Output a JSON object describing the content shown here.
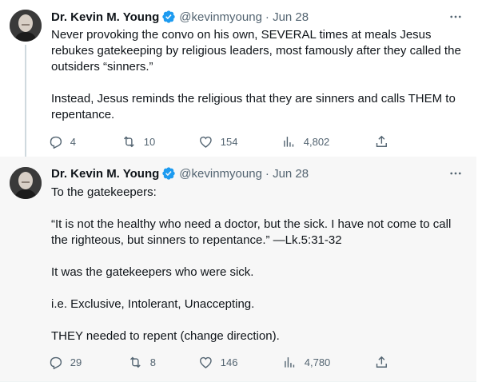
{
  "colors": {
    "text": "#0f1419",
    "secondary": "#536471",
    "verified": "#1d9bf0",
    "thread_line": "#cfd9de",
    "highlight_bg": "#f7f7f7"
  },
  "tweets": [
    {
      "author": {
        "name": "Dr. Kevin M. Young",
        "handle": "@kevinmyoung",
        "date": "· Jun 28"
      },
      "text": [
        "Never provoking the convo on his own, SEVERAL times at meals Jesus rebukes gatekeeping by religious leaders, most famously after they called the outsiders “sinners.”",
        "Instead, Jesus reminds the religious that they are sinners and calls THEM to repentance."
      ],
      "stats": {
        "replies": "4",
        "retweets": "10",
        "likes": "154",
        "views": "4,802"
      }
    },
    {
      "author": {
        "name": "Dr. Kevin M. Young",
        "handle": "@kevinmyoung",
        "date": "· Jun 28"
      },
      "text": [
        "To the gatekeepers:",
        "“It is not the healthy who need a doctor, but the sick. I have not come to call the righteous, but sinners to repentance.” —Lk.5:31-32",
        "It was the gatekeepers who were sick.",
        "i.e. Exclusive, Intolerant, Unaccepting.",
        "THEY needed to repent (change direction)."
      ],
      "stats": {
        "replies": "29",
        "retweets": "8",
        "likes": "146",
        "views": "4,780"
      }
    }
  ],
  "icons": {
    "verified": "verified-badge-icon",
    "more": "more-dots-icon",
    "reply": "reply-icon",
    "retweet": "retweet-icon",
    "like": "heart-icon",
    "views": "views-chart-icon",
    "share": "share-icon"
  }
}
